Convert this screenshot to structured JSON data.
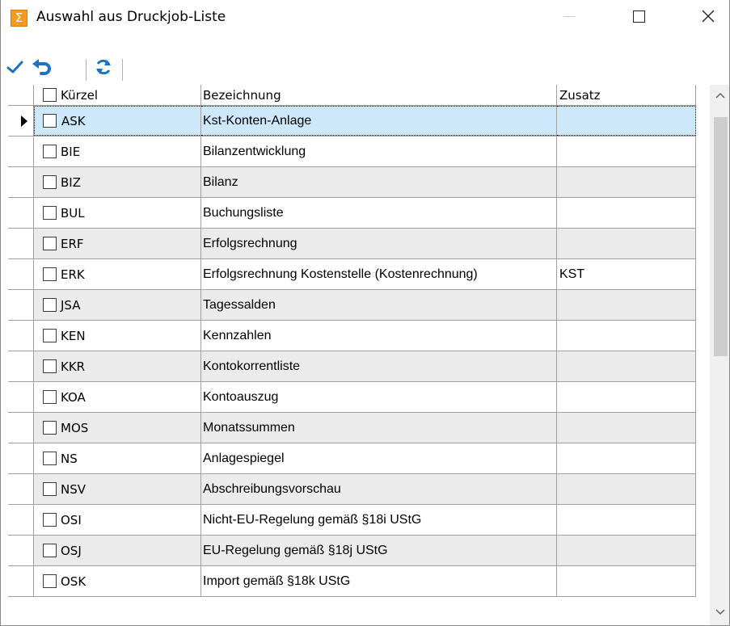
{
  "window": {
    "title": "Auswahl aus Druckjob-Liste",
    "icon": "sigma-icon",
    "accent_color": "#f39a1f"
  },
  "toolbar": {
    "buttons": [
      {
        "name": "confirm-button",
        "icon": "checkmark-icon",
        "color": "#1a73c7"
      },
      {
        "name": "undo-button",
        "icon": "undo-icon",
        "color": "#1a73c7"
      },
      {
        "name": "refresh-button",
        "icon": "refresh-icon",
        "color": "#1a73c7"
      }
    ]
  },
  "grid": {
    "columns": {
      "code": "Kürzel",
      "description": "Bezeichnung",
      "extra": "Zusatz"
    },
    "selected_index": 0,
    "selection_color": "#cde8fb",
    "rows": [
      {
        "code": "ASK",
        "description": "Kst-Konten-Anlage",
        "extra": ""
      },
      {
        "code": "BIE",
        "description": "Bilanzentwicklung",
        "extra": ""
      },
      {
        "code": "BIZ",
        "description": "Bilanz",
        "extra": ""
      },
      {
        "code": "BUL",
        "description": "Buchungsliste",
        "extra": ""
      },
      {
        "code": "ERF",
        "description": "Erfolgsrechnung",
        "extra": ""
      },
      {
        "code": "ERK",
        "description": "Erfolgsrechnung Kostenstelle (Kostenrechnung)",
        "extra": "KST"
      },
      {
        "code": "JSA",
        "description": "Tagessalden",
        "extra": ""
      },
      {
        "code": "KEN",
        "description": "Kennzahlen",
        "extra": ""
      },
      {
        "code": "KKR",
        "description": "Kontokorrentliste",
        "extra": ""
      },
      {
        "code": "KOA",
        "description": "Kontoauszug",
        "extra": ""
      },
      {
        "code": "MOS",
        "description": "Monatssummen",
        "extra": ""
      },
      {
        "code": "NS",
        "description": "Anlagespiegel",
        "extra": ""
      },
      {
        "code": "NSV",
        "description": "Abschreibungsvorschau",
        "extra": ""
      },
      {
        "code": "OSI",
        "description": "Nicht-EU-Regelung gemäß §18i UStG",
        "extra": ""
      },
      {
        "code": "OSJ",
        "description": "EU-Regelung gemäß §18j UStG",
        "extra": ""
      },
      {
        "code": "OSK",
        "description": "Import gemäß §18k UStG",
        "extra": ""
      }
    ]
  }
}
